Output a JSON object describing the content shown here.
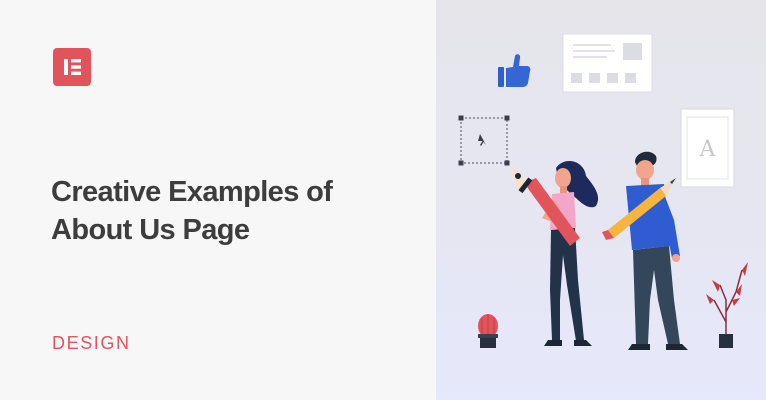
{
  "title_lines": [
    "Creative Examples of",
    "About Us Page"
  ],
  "category": "DESIGN",
  "illustration": {
    "card_letter": "A"
  },
  "colors": {
    "brand": "#e2545b",
    "title": "#3d3d3d",
    "left_background": "#f7f7f7"
  },
  "icons": [
    "elementor-logo-icon",
    "thumbs-up-icon",
    "cursor-icon",
    "pen-tool-icon",
    "pencil-icon",
    "cactus-icon",
    "plant-icon"
  ]
}
